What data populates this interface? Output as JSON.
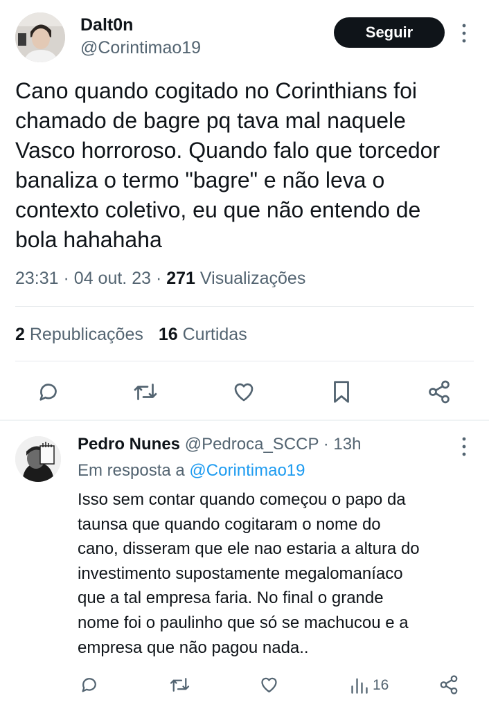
{
  "tweet": {
    "display_name": "Dalt0n",
    "handle": "@Corintimao19",
    "follow_label": "Seguir",
    "text": "Cano quando cogitado no Corinthians foi\nchamado de bagre pq tava mal naquele\nVasco horroroso. Quando falo que torcedor\nbanaliza o termo \"bagre\" e não leva o\ncontexto coletivo, eu que não entendo de\nbola hahahaha",
    "time": "23:31",
    "date": "04 out. 23",
    "views_count": "271",
    "views_label": "Visualizações",
    "reposts_count": "2",
    "reposts_label": "Republicações",
    "likes_count": "16",
    "likes_label": "Curtidas",
    "actions": [
      "reply-icon",
      "repost-icon",
      "like-icon",
      "bookmark-icon",
      "share-icon"
    ]
  },
  "reply": {
    "display_name": "Pedro Nunes",
    "handle": "@Pedroca_SCCP",
    "age": "13h",
    "reply_prefix": "Em resposta a",
    "reply_mention": "@Corintimao19",
    "text": "Isso sem contar quando começou o papo da\ntaunsa que quando cogitaram o nome do\ncano, disseram que ele nao estaria a altura do\ninvestimento supostamente megalomaníaco\nque a tal empresa faria. No final o grande\nnome foi o paulinho que só se machucou e a\nempresa que não pagou nada..",
    "views_count": "16",
    "actions": [
      "reply-icon",
      "repost-icon",
      "like-icon",
      "views-icon",
      "share-icon"
    ]
  },
  "colors": {
    "text": "#0f1419",
    "secondary": "#536471",
    "link": "#1d9bf0",
    "button_bg": "#0f1419",
    "divider": "#e6e9ec"
  }
}
